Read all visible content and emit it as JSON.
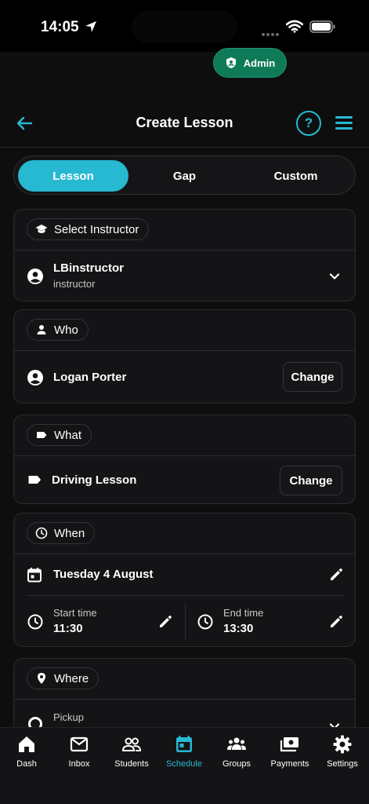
{
  "status_bar": {
    "time": "14:05"
  },
  "admin_badge": {
    "label": "Admin"
  },
  "header": {
    "title": "Create Lesson",
    "help_label": "?"
  },
  "tabs": [
    {
      "label": "Lesson",
      "active": true
    },
    {
      "label": "Gap",
      "active": false
    },
    {
      "label": "Custom",
      "active": false
    }
  ],
  "instructor_card": {
    "chip_label": "Select Instructor",
    "name": "LBinstructor",
    "role": "instructor"
  },
  "who_card": {
    "chip_label": "Who",
    "name": "Logan Porter",
    "change_label": "Change"
  },
  "what_card": {
    "chip_label": "What",
    "lesson_type": "Driving Lesson",
    "change_label": "Change"
  },
  "when_card": {
    "chip_label": "When",
    "date": "Tuesday 4 August",
    "start_label": "Start time",
    "start_time": "11:30",
    "end_label": "End time",
    "end_time": "13:30"
  },
  "where_card": {
    "chip_label": "Where",
    "pickup_label": "Pickup"
  },
  "bottom_nav": [
    {
      "label": "Dash",
      "icon": "home-icon",
      "active": false
    },
    {
      "label": "Inbox",
      "icon": "mail-icon",
      "active": false
    },
    {
      "label": "Students",
      "icon": "people-icon",
      "active": false
    },
    {
      "label": "Schedule",
      "icon": "calendar-icon",
      "active": true
    },
    {
      "label": "Groups",
      "icon": "groups-icon",
      "active": false
    },
    {
      "label": "Payments",
      "icon": "payments-icon",
      "active": false
    },
    {
      "label": "Settings",
      "icon": "gear-icon",
      "active": false
    }
  ],
  "colors": {
    "accent": "#27b8d2",
    "admin_green": "#0f7a58",
    "background": "#0e0e0f",
    "card": "#141416"
  }
}
